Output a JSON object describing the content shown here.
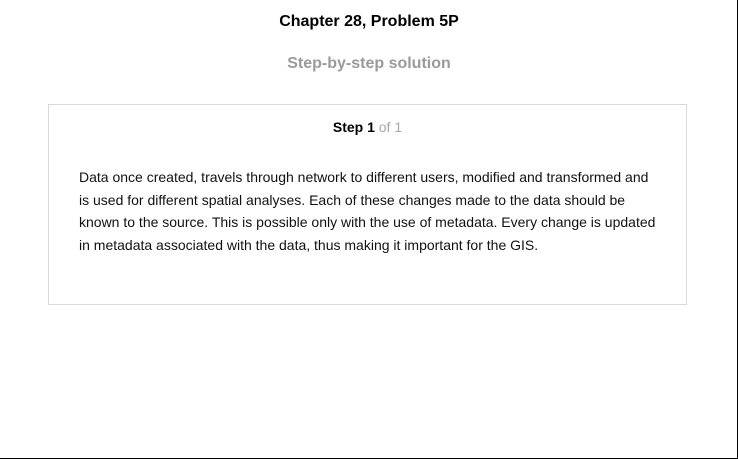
{
  "header": {
    "title": "Chapter 28, Problem 5P",
    "subtitle": "Step-by-step solution"
  },
  "step": {
    "label": "Step 1",
    "of": "of 1",
    "text": "Data once created, travels through network to different users, modified and transformed and is used for different spatial analyses. Each of these changes made to the data should be known to the source. This is possible only with the use of metadata. Every change is updated in metadata associated with the data, thus making it important for the GIS."
  }
}
